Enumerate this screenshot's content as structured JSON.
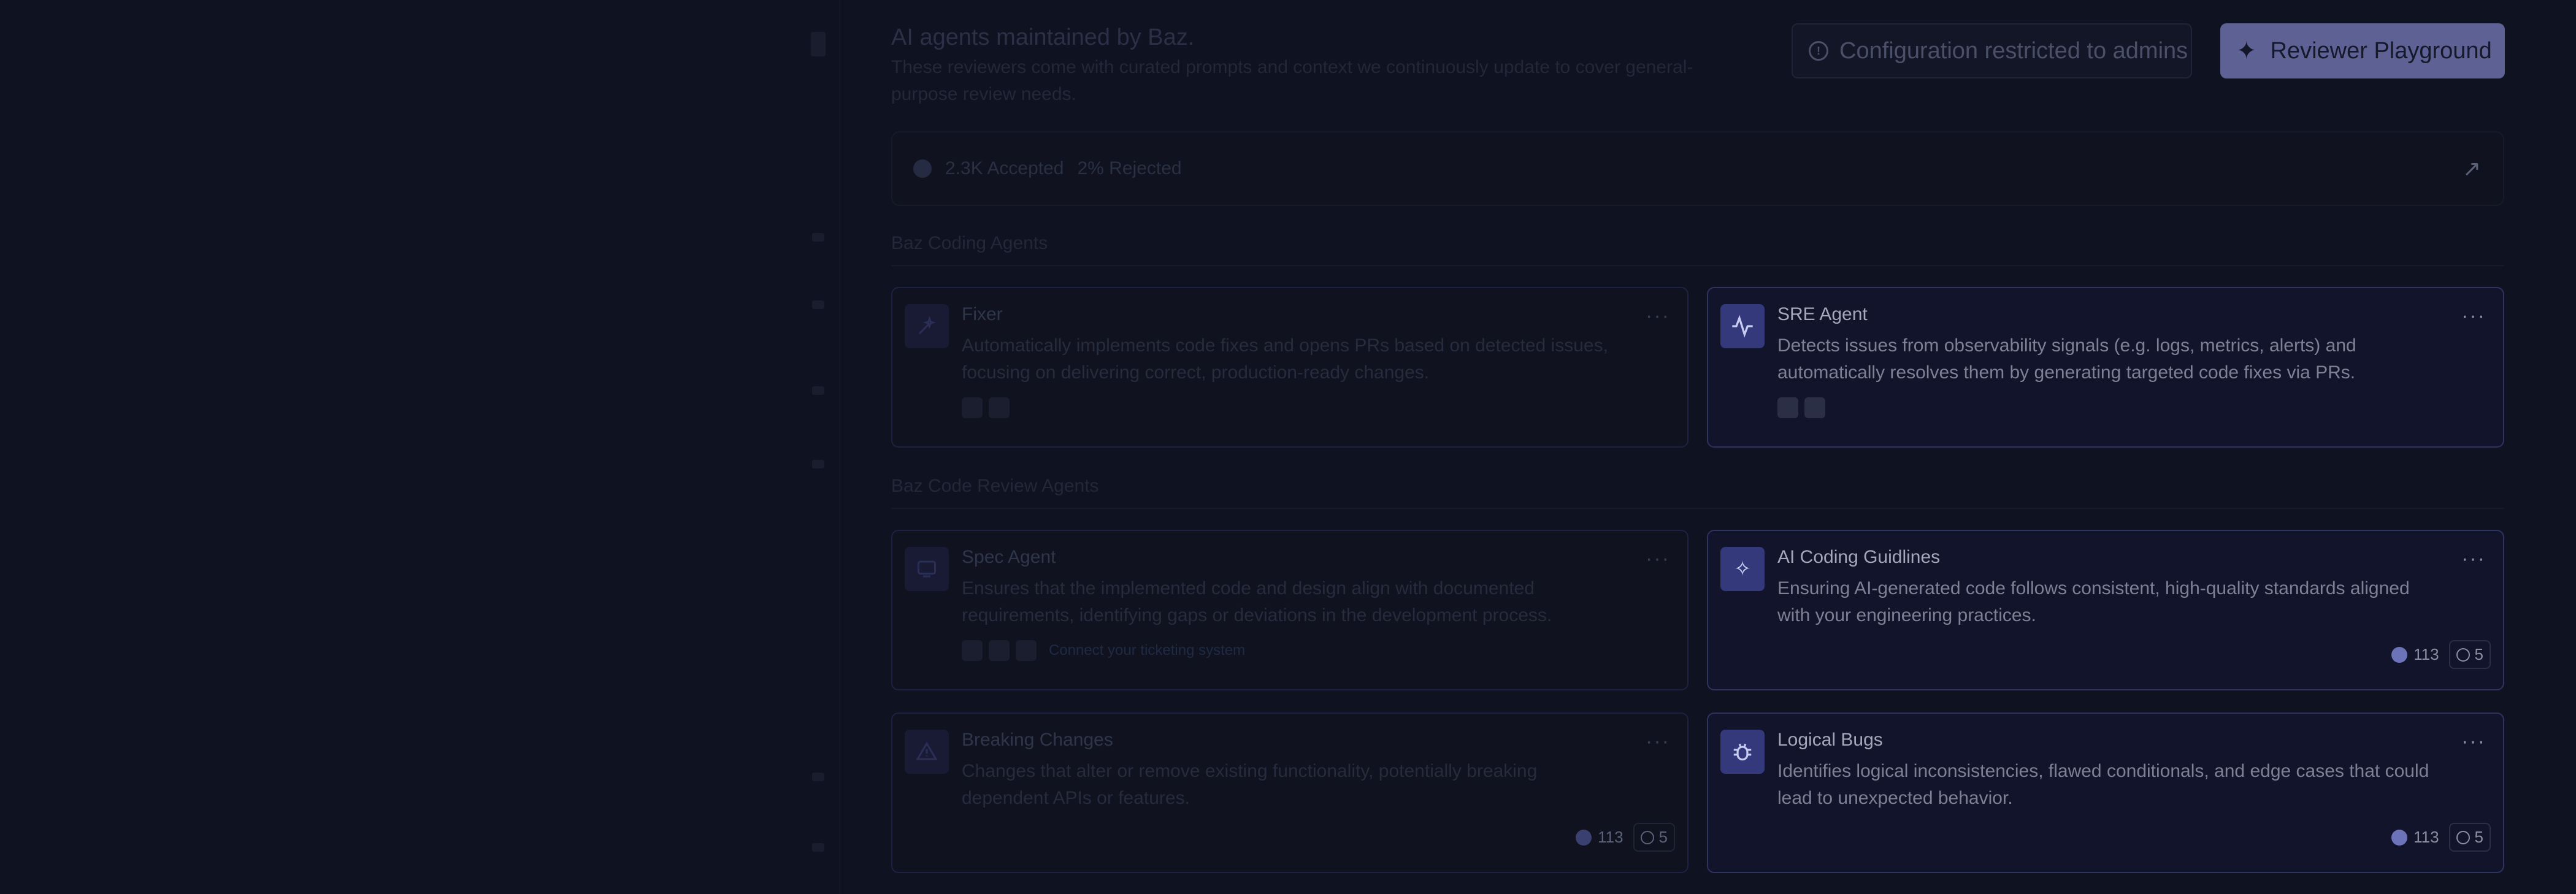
{
  "header": {
    "title": "AI agents maintained by Baz.",
    "description": "These reviewers come with curated prompts and context we continuously update to cover general-purpose review needs.",
    "restricted_label": "Configuration restricted to admins",
    "restricted_icon": "info-circle-icon",
    "playground_label": "Reviewer Playground",
    "playground_icon": "sparkle-icon"
  },
  "stats": {
    "accepted": "2.3K Accepted",
    "rejected": "2% Rejected"
  },
  "sections": {
    "coding": "Baz Coding Agents",
    "review": "Baz Code Review Agents"
  },
  "coding_agents": [
    {
      "title": "Fixer",
      "description": "Automatically implements code fixes and opens PRs based on detected issues, focusing on delivering correct, production-ready changes.",
      "icon": "wand-icon"
    },
    {
      "title": "SRE Agent",
      "description": "Detects issues from observability signals (e.g. logs, metrics, alerts) and automatically resolves them by generating targeted code fixes via PRs.",
      "icon": "pulse-icon"
    }
  ],
  "review_agents": [
    {
      "title": "Spec Agent",
      "description": "Ensures that the implemented code and design align with documented requirements, identifying gaps or deviations in the development process.",
      "icon": "monitor-icon",
      "connect": "Connect your ticketing system"
    },
    {
      "title": "AI Coding Guidlines",
      "description": "Ensuring AI-generated code follows consistent, high-quality standards aligned with your engineering practices.",
      "icon": "sparkle-icon",
      "accepted": "113",
      "rejected": "5"
    },
    {
      "title": "Breaking Changes",
      "description": "Changes that alter or remove existing functionality, potentially breaking dependent APIs or features.",
      "icon": "warning-icon",
      "accepted": "113",
      "rejected": "5"
    },
    {
      "title": "Logical Bugs",
      "description": "Identifies logical inconsistencies, flawed conditionals, and edge cases that could lead to unexpected behavior.",
      "icon": "bug-icon",
      "accepted": "113",
      "rejected": "5"
    }
  ],
  "menu_glyph": "···",
  "colors": {
    "background": "#0f1220",
    "accent": "#5d6193",
    "card_border_active": "#2e3360"
  }
}
